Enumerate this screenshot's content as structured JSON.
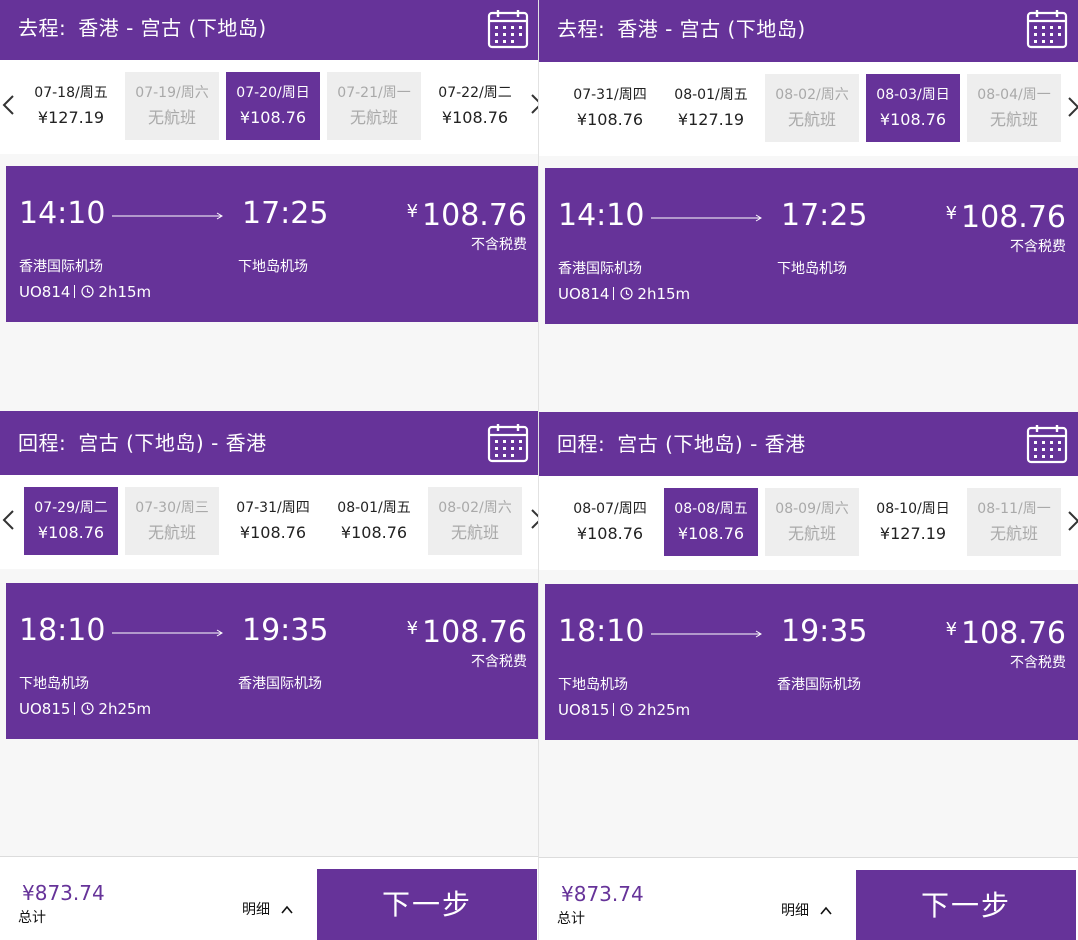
{
  "colors": {
    "brand": "#663399",
    "unavailable_bg": "#eeeeee",
    "unavailable_text": "#a9a9a9"
  },
  "panels": [
    {
      "outbound": {
        "label": "去程:",
        "route": "香港 - 宫古 (下地岛)",
        "dates": [
          {
            "date": "07-18/周五",
            "price": "¥127.19",
            "state": "available"
          },
          {
            "date": "07-19/周六",
            "price": "无航班",
            "state": "unavailable"
          },
          {
            "date": "07-20/周日",
            "price": "¥108.76",
            "state": "selected"
          },
          {
            "date": "07-21/周一",
            "price": "无航班",
            "state": "unavailable"
          },
          {
            "date": "07-22/周二",
            "price": "¥108.76",
            "state": "available"
          }
        ],
        "flight": {
          "dep_time": "14:10",
          "arr_time": "17:25",
          "price": "108.76",
          "currency": "¥",
          "tax_note": "不含税费",
          "dep_airport": "香港国际机场",
          "arr_airport": "下地岛机场",
          "flight_no": "UO814",
          "duration": "2h15m"
        }
      },
      "return": {
        "label": "回程:",
        "route": "宫古 (下地岛) - 香港",
        "dates": [
          {
            "date": "07-29/周二",
            "price": "¥108.76",
            "state": "selected"
          },
          {
            "date": "07-30/周三",
            "price": "无航班",
            "state": "unavailable"
          },
          {
            "date": "07-31/周四",
            "price": "¥108.76",
            "state": "available"
          },
          {
            "date": "08-01/周五",
            "price": "¥108.76",
            "state": "available"
          },
          {
            "date": "08-02/周六",
            "price": "无航班",
            "state": "unavailable"
          }
        ],
        "flight": {
          "dep_time": "18:10",
          "arr_time": "19:35",
          "price": "108.76",
          "currency": "¥",
          "tax_note": "不含税费",
          "dep_airport": "下地岛机场",
          "arr_airport": "香港国际机场",
          "flight_no": "UO815",
          "duration": "2h25m"
        }
      },
      "footer": {
        "total_price": "¥873.74",
        "total_label": "总计",
        "details_label": "明细",
        "next_label": "下一步"
      }
    },
    {
      "outbound": {
        "label": "去程:",
        "route": "香港 - 宫古 (下地岛)",
        "dates": [
          {
            "date": "07-31/周四",
            "price": "¥108.76",
            "state": "available"
          },
          {
            "date": "08-01/周五",
            "price": "¥127.19",
            "state": "available"
          },
          {
            "date": "08-02/周六",
            "price": "无航班",
            "state": "unavailable"
          },
          {
            "date": "08-03/周日",
            "price": "¥108.76",
            "state": "selected"
          },
          {
            "date": "08-04/周一",
            "price": "无航班",
            "state": "unavailable"
          }
        ],
        "flight": {
          "dep_time": "14:10",
          "arr_time": "17:25",
          "price": "108.76",
          "currency": "¥",
          "tax_note": "不含税费",
          "dep_airport": "香港国际机场",
          "arr_airport": "下地岛机场",
          "flight_no": "UO814",
          "duration": "2h15m"
        }
      },
      "return": {
        "label": "回程:",
        "route": "宫古 (下地岛) - 香港",
        "dates": [
          {
            "date": "08-07/周四",
            "price": "¥108.76",
            "state": "available"
          },
          {
            "date": "08-08/周五",
            "price": "¥108.76",
            "state": "selected"
          },
          {
            "date": "08-09/周六",
            "price": "无航班",
            "state": "unavailable"
          },
          {
            "date": "08-10/周日",
            "price": "¥127.19",
            "state": "available"
          },
          {
            "date": "08-11/周一",
            "price": "无航班",
            "state": "unavailable"
          }
        ],
        "flight": {
          "dep_time": "18:10",
          "arr_time": "19:35",
          "price": "108.76",
          "currency": "¥",
          "tax_note": "不含税费",
          "dep_airport": "下地岛机场",
          "arr_airport": "香港国际机场",
          "flight_no": "UO815",
          "duration": "2h25m"
        }
      },
      "footer": {
        "total_price": "¥873.74",
        "total_label": "总计",
        "details_label": "明细",
        "next_label": "下一步"
      }
    }
  ]
}
